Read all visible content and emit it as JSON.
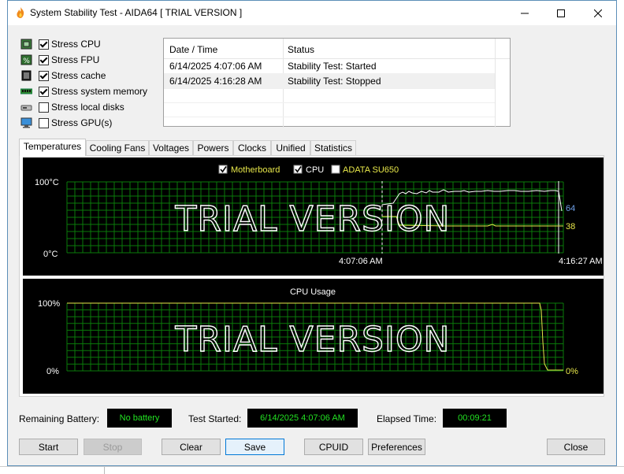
{
  "window": {
    "title": "System Stability Test - AIDA64  [ TRIAL VERSION ]"
  },
  "stress_options": [
    {
      "label": "Stress CPU",
      "checked": true,
      "icon": "cpu-chip-icon"
    },
    {
      "label": "Stress FPU",
      "checked": true,
      "icon": "fpu-chip-icon"
    },
    {
      "label": "Stress cache",
      "checked": true,
      "icon": "cache-chip-icon"
    },
    {
      "label": "Stress system memory",
      "checked": true,
      "icon": "memory-module-icon"
    },
    {
      "label": "Stress local disks",
      "checked": false,
      "icon": "disk-drive-icon"
    },
    {
      "label": "Stress GPU(s)",
      "checked": false,
      "icon": "monitor-icon"
    }
  ],
  "log": {
    "headers": [
      "Date / Time",
      "Status"
    ],
    "rows": [
      {
        "time": "6/14/2025 4:07:06 AM",
        "status": "Stability Test: Started"
      },
      {
        "time": "6/14/2025 4:16:28 AM",
        "status": "Stability Test: Stopped"
      }
    ]
  },
  "tabs": [
    "Temperatures",
    "Cooling Fans",
    "Voltages",
    "Powers",
    "Clocks",
    "Unified",
    "Statistics"
  ],
  "temperature_graph": {
    "legend": [
      {
        "label": "Motherboard",
        "checked": true,
        "color": "#e8e84a"
      },
      {
        "label": "CPU",
        "checked": true,
        "color": "#ffffff"
      },
      {
        "label": "ADATA SU650",
        "checked": false,
        "color": "#e8e84a"
      }
    ],
    "y_max_label": "100°C",
    "y_min_label": "0°C",
    "x_start_label": "4:07:06 AM",
    "x_end_label": "4:16:27 AM",
    "value_cpu": "64",
    "value_mb": "38",
    "watermark": "TRIAL VERSION"
  },
  "cpu_graph": {
    "title": "CPU Usage",
    "y_max_label": "100%",
    "y_min_label": "0%",
    "value": "0%",
    "watermark": "TRIAL VERSION"
  },
  "status": {
    "battery_label": "Remaining Battery:",
    "battery_value": "No battery",
    "started_label": "Test Started:",
    "started_value": "6/14/2025 4:07:06 AM",
    "elapsed_label": "Elapsed Time:",
    "elapsed_value": "00:09:21"
  },
  "buttons": {
    "start": "Start",
    "stop": "Stop",
    "clear": "Clear",
    "save": "Save",
    "cpuid": "CPUID",
    "preferences": "Preferences",
    "close": "Close"
  },
  "colors": {
    "grid": "#0a7a0a",
    "status_text": "#22e222",
    "accent": "#0078d7"
  }
}
